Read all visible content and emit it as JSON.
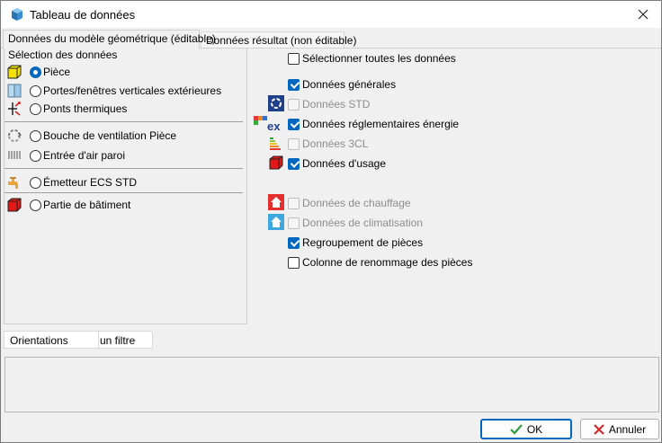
{
  "window": {
    "title": "Tableau de données"
  },
  "tabs": [
    {
      "label": "Données du modèle géométrique (éditable)"
    },
    {
      "label": "Données résultat (non éditable)"
    }
  ],
  "selection": {
    "group_label": "Sélection des données",
    "options": [
      {
        "label": "Pièce",
        "checked": true,
        "icon": "yellow-cube-icon"
      },
      {
        "label": "Portes/fenêtres verticales extérieures",
        "checked": false,
        "icon": "window-icon"
      },
      {
        "label": "Ponts thermiques",
        "checked": false,
        "icon": "thermal-bridge-icon"
      },
      {
        "label": "Bouche de ventilation Pièce",
        "checked": false,
        "icon": "ventilation-icon"
      },
      {
        "label": "Entrée d'air paroi",
        "checked": false,
        "icon": "air-inlet-icon"
      },
      {
        "label": "Émetteur ECS STD",
        "checked": false,
        "icon": "faucet-icon"
      },
      {
        "label": "Partie de bâtiment",
        "checked": false,
        "icon": "red-cube-icon"
      }
    ]
  },
  "checkboxes": [
    {
      "label": "Sélectionner toutes les données",
      "checked": false,
      "enabled": true
    },
    {
      "label": "Données générales",
      "checked": true,
      "enabled": true
    },
    {
      "label": "Données STD",
      "checked": false,
      "enabled": false,
      "icon": "std-icon"
    },
    {
      "label": "Données réglementaires énergie",
      "checked": true,
      "enabled": true,
      "icon": "ex-icon",
      "icon_text": "ex"
    },
    {
      "label": "Données 3CL",
      "checked": false,
      "enabled": false,
      "icon": "energy-label-icon"
    },
    {
      "label": "Données d'usage",
      "checked": true,
      "enabled": true,
      "icon": "red-cube-icon"
    },
    {
      "label": "Données de chauffage",
      "checked": false,
      "enabled": false,
      "icon": "house-heating-icon"
    },
    {
      "label": "Données de climatisation",
      "checked": false,
      "enabled": false,
      "icon": "house-cooling-icon"
    },
    {
      "label": "Regroupement de pièces",
      "checked": true,
      "enabled": true
    },
    {
      "label": "Colonne de renommage des pièces",
      "checked": false,
      "enabled": true
    }
  ],
  "bottom_tabs": [
    {
      "label": "Orientations"
    },
    {
      "label": "un filtre"
    }
  ],
  "buttons": {
    "ok": "OK",
    "cancel": "Annuler"
  },
  "colors": {
    "accent": "#0067c0",
    "ok_check": "#2e9e3e",
    "cancel_x": "#d62a2a"
  }
}
